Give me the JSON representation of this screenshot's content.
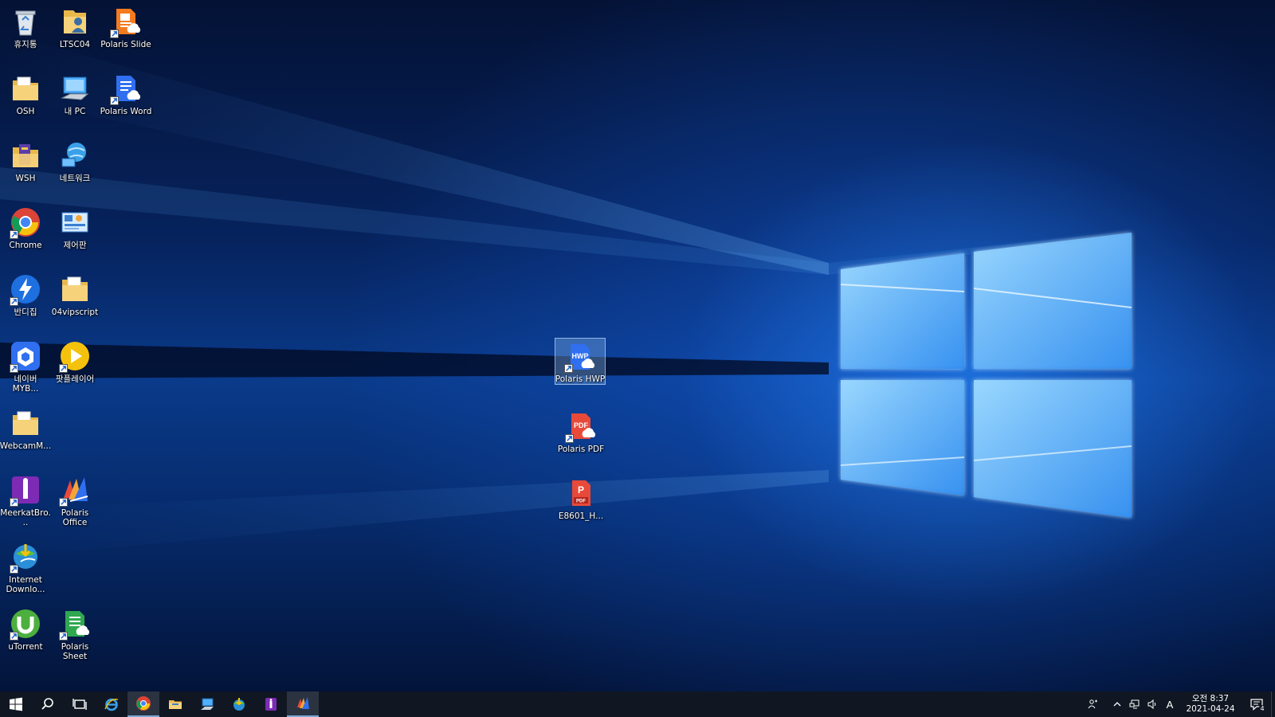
{
  "desktop": {
    "icons": {
      "recycle_bin": "휴지통",
      "ltsc04": "LTSC04",
      "polaris_slide": "Polaris Slide",
      "osh": "OSH",
      "my_pc": "내 PC",
      "polaris_word": "Polaris Word",
      "wsh": "WSH",
      "network": "네트워크",
      "chrome": "Chrome",
      "control_panel": "제어판",
      "bandizip": "반디집",
      "vipscript": "04vipscript",
      "naver_mybox": "네이버\nMYB...",
      "potplayer": "팟플레이어",
      "webcam": "WebcamM...",
      "meerkat": "MeerkatBro...",
      "polaris_office": "Polaris Office",
      "idm": "Internet\nDownlo...",
      "utorrent": "uTorrent",
      "polaris_sheet": "Polaris Sheet",
      "polaris_hwp": "Polaris HWP",
      "polaris_pdf": "Polaris PDF",
      "e8601": "E8601_H..."
    },
    "badges": {
      "hwp": "HWP",
      "pdf": "PDF",
      "pdf_small": "PDF"
    }
  },
  "taskbar": {
    "ime_indicator": "A",
    "clock_time": "오전 8:37",
    "clock_date": "2021-04-24",
    "notification_count": "4"
  },
  "colors": {
    "taskbar_bg": "#101722",
    "accent": "#7aa8d8",
    "window_logo": "#8fd0ff"
  }
}
